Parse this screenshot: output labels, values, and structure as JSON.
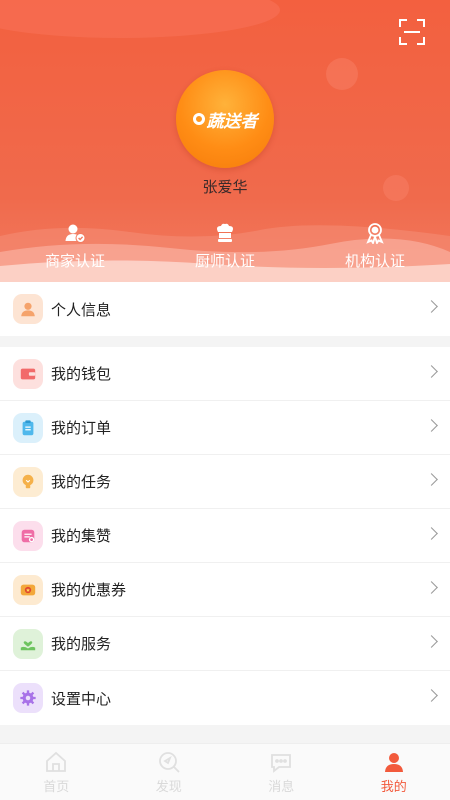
{
  "header": {
    "logo_text": "蔬送者",
    "username": "张爱华",
    "certs": [
      {
        "label": "商家认证",
        "icon": "merchant-user-icon"
      },
      {
        "label": "厨师认证",
        "icon": "chef-hat-icon"
      },
      {
        "label": "机构认证",
        "icon": "medal-icon"
      }
    ]
  },
  "profile_row": {
    "label": "个人信息",
    "icon": "person-icon",
    "color": "#f5a36b"
  },
  "menu": [
    {
      "label": "我的钱包",
      "icon": "wallet-icon",
      "color": "#f26a6a"
    },
    {
      "label": "我的订单",
      "icon": "clipboard-icon",
      "color": "#4fb8ec"
    },
    {
      "label": "我的任务",
      "icon": "lightbulb-icon",
      "color": "#f5b14a"
    },
    {
      "label": "我的集赞",
      "icon": "note-icon",
      "color": "#ef6da6"
    },
    {
      "label": "我的优惠券",
      "icon": "coupon-icon",
      "color": "#f3a83a"
    },
    {
      "label": "我的服务",
      "icon": "heart-hand-icon",
      "color": "#6ec45f"
    },
    {
      "label": "设置中心",
      "icon": "gear-icon",
      "color": "#a872e8"
    }
  ],
  "tabbar": [
    {
      "label": "首页",
      "icon": "home-icon",
      "active": false
    },
    {
      "label": "发现",
      "icon": "discover-icon",
      "active": false
    },
    {
      "label": "消息",
      "icon": "message-icon",
      "active": false
    },
    {
      "label": "我的",
      "icon": "profile-icon",
      "active": true
    }
  ],
  "colors": {
    "accent": "#f25a3c",
    "header_top": "#f3603f"
  }
}
